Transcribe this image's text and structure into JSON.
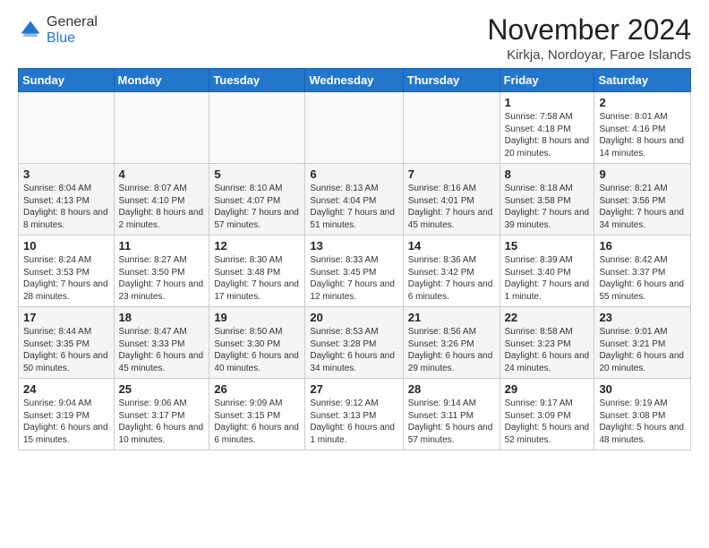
{
  "logo": {
    "general": "General",
    "blue": "Blue"
  },
  "header": {
    "month": "November 2024",
    "location": "Kirkja, Nordoyar, Faroe Islands"
  },
  "weekdays": [
    "Sunday",
    "Monday",
    "Tuesday",
    "Wednesday",
    "Thursday",
    "Friday",
    "Saturday"
  ],
  "weeks": [
    [
      {
        "day": "",
        "info": ""
      },
      {
        "day": "",
        "info": ""
      },
      {
        "day": "",
        "info": ""
      },
      {
        "day": "",
        "info": ""
      },
      {
        "day": "",
        "info": ""
      },
      {
        "day": "1",
        "info": "Sunrise: 7:58 AM\nSunset: 4:18 PM\nDaylight: 8 hours and 20 minutes."
      },
      {
        "day": "2",
        "info": "Sunrise: 8:01 AM\nSunset: 4:16 PM\nDaylight: 8 hours and 14 minutes."
      }
    ],
    [
      {
        "day": "3",
        "info": "Sunrise: 8:04 AM\nSunset: 4:13 PM\nDaylight: 8 hours and 8 minutes."
      },
      {
        "day": "4",
        "info": "Sunrise: 8:07 AM\nSunset: 4:10 PM\nDaylight: 8 hours and 2 minutes."
      },
      {
        "day": "5",
        "info": "Sunrise: 8:10 AM\nSunset: 4:07 PM\nDaylight: 7 hours and 57 minutes."
      },
      {
        "day": "6",
        "info": "Sunrise: 8:13 AM\nSunset: 4:04 PM\nDaylight: 7 hours and 51 minutes."
      },
      {
        "day": "7",
        "info": "Sunrise: 8:16 AM\nSunset: 4:01 PM\nDaylight: 7 hours and 45 minutes."
      },
      {
        "day": "8",
        "info": "Sunrise: 8:18 AM\nSunset: 3:58 PM\nDaylight: 7 hours and 39 minutes."
      },
      {
        "day": "9",
        "info": "Sunrise: 8:21 AM\nSunset: 3:56 PM\nDaylight: 7 hours and 34 minutes."
      }
    ],
    [
      {
        "day": "10",
        "info": "Sunrise: 8:24 AM\nSunset: 3:53 PM\nDaylight: 7 hours and 28 minutes."
      },
      {
        "day": "11",
        "info": "Sunrise: 8:27 AM\nSunset: 3:50 PM\nDaylight: 7 hours and 23 minutes."
      },
      {
        "day": "12",
        "info": "Sunrise: 8:30 AM\nSunset: 3:48 PM\nDaylight: 7 hours and 17 minutes."
      },
      {
        "day": "13",
        "info": "Sunrise: 8:33 AM\nSunset: 3:45 PM\nDaylight: 7 hours and 12 minutes."
      },
      {
        "day": "14",
        "info": "Sunrise: 8:36 AM\nSunset: 3:42 PM\nDaylight: 7 hours and 6 minutes."
      },
      {
        "day": "15",
        "info": "Sunrise: 8:39 AM\nSunset: 3:40 PM\nDaylight: 7 hours and 1 minute."
      },
      {
        "day": "16",
        "info": "Sunrise: 8:42 AM\nSunset: 3:37 PM\nDaylight: 6 hours and 55 minutes."
      }
    ],
    [
      {
        "day": "17",
        "info": "Sunrise: 8:44 AM\nSunset: 3:35 PM\nDaylight: 6 hours and 50 minutes."
      },
      {
        "day": "18",
        "info": "Sunrise: 8:47 AM\nSunset: 3:33 PM\nDaylight: 6 hours and 45 minutes."
      },
      {
        "day": "19",
        "info": "Sunrise: 8:50 AM\nSunset: 3:30 PM\nDaylight: 6 hours and 40 minutes."
      },
      {
        "day": "20",
        "info": "Sunrise: 8:53 AM\nSunset: 3:28 PM\nDaylight: 6 hours and 34 minutes."
      },
      {
        "day": "21",
        "info": "Sunrise: 8:56 AM\nSunset: 3:26 PM\nDaylight: 6 hours and 29 minutes."
      },
      {
        "day": "22",
        "info": "Sunrise: 8:58 AM\nSunset: 3:23 PM\nDaylight: 6 hours and 24 minutes."
      },
      {
        "day": "23",
        "info": "Sunrise: 9:01 AM\nSunset: 3:21 PM\nDaylight: 6 hours and 20 minutes."
      }
    ],
    [
      {
        "day": "24",
        "info": "Sunrise: 9:04 AM\nSunset: 3:19 PM\nDaylight: 6 hours and 15 minutes."
      },
      {
        "day": "25",
        "info": "Sunrise: 9:06 AM\nSunset: 3:17 PM\nDaylight: 6 hours and 10 minutes."
      },
      {
        "day": "26",
        "info": "Sunrise: 9:09 AM\nSunset: 3:15 PM\nDaylight: 6 hours and 6 minutes."
      },
      {
        "day": "27",
        "info": "Sunrise: 9:12 AM\nSunset: 3:13 PM\nDaylight: 6 hours and 1 minute."
      },
      {
        "day": "28",
        "info": "Sunrise: 9:14 AM\nSunset: 3:11 PM\nDaylight: 5 hours and 57 minutes."
      },
      {
        "day": "29",
        "info": "Sunrise: 9:17 AM\nSunset: 3:09 PM\nDaylight: 5 hours and 52 minutes."
      },
      {
        "day": "30",
        "info": "Sunrise: 9:19 AM\nSunset: 3:08 PM\nDaylight: 5 hours and 48 minutes."
      }
    ]
  ]
}
